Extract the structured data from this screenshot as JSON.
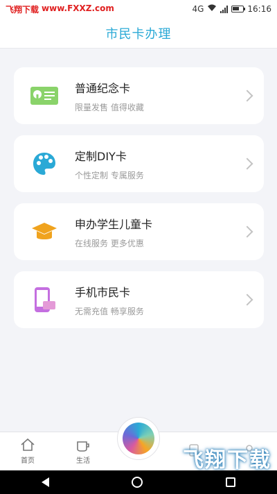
{
  "status_bar": {
    "watermark_left": "飞翔下载",
    "watermark_url": "www.FXXZ.com",
    "signal_text": "4G",
    "time": "16:16"
  },
  "header": {
    "title": "市民卡办理"
  },
  "cards": [
    {
      "title": "普通纪念卡",
      "subtitle": "限量发售 值得收藏",
      "icon": "commemorative-card-icon",
      "icon_color": "#8ad36a"
    },
    {
      "title": "定制DIY卡",
      "subtitle": "个性定制 专属服务",
      "icon": "palette-icon",
      "icon_color": "#2aa9d6"
    },
    {
      "title": "申办学生儿童卡",
      "subtitle": "在线服务 更多优惠",
      "icon": "graduation-cap-icon",
      "icon_color": "#f0a31e"
    },
    {
      "title": "手机市民卡",
      "subtitle": "无需充值 畅享服务",
      "icon": "phone-card-icon",
      "icon_color": "#c46fe0"
    }
  ],
  "tabbar": {
    "tabs": [
      {
        "label": "首页",
        "icon": "home-icon"
      },
      {
        "label": "生活",
        "icon": "cup-icon"
      },
      {
        "label": "",
        "icon": "center-app-icon"
      },
      {
        "label": "",
        "icon": "card-icon"
      },
      {
        "label": "",
        "icon": "user-icon"
      }
    ]
  },
  "watermark": {
    "brand": "飞翔下载",
    "url": "WWW.FXXZ.COM"
  },
  "colors": {
    "accent": "#2aa9d6",
    "background": "#f3f4f8"
  }
}
